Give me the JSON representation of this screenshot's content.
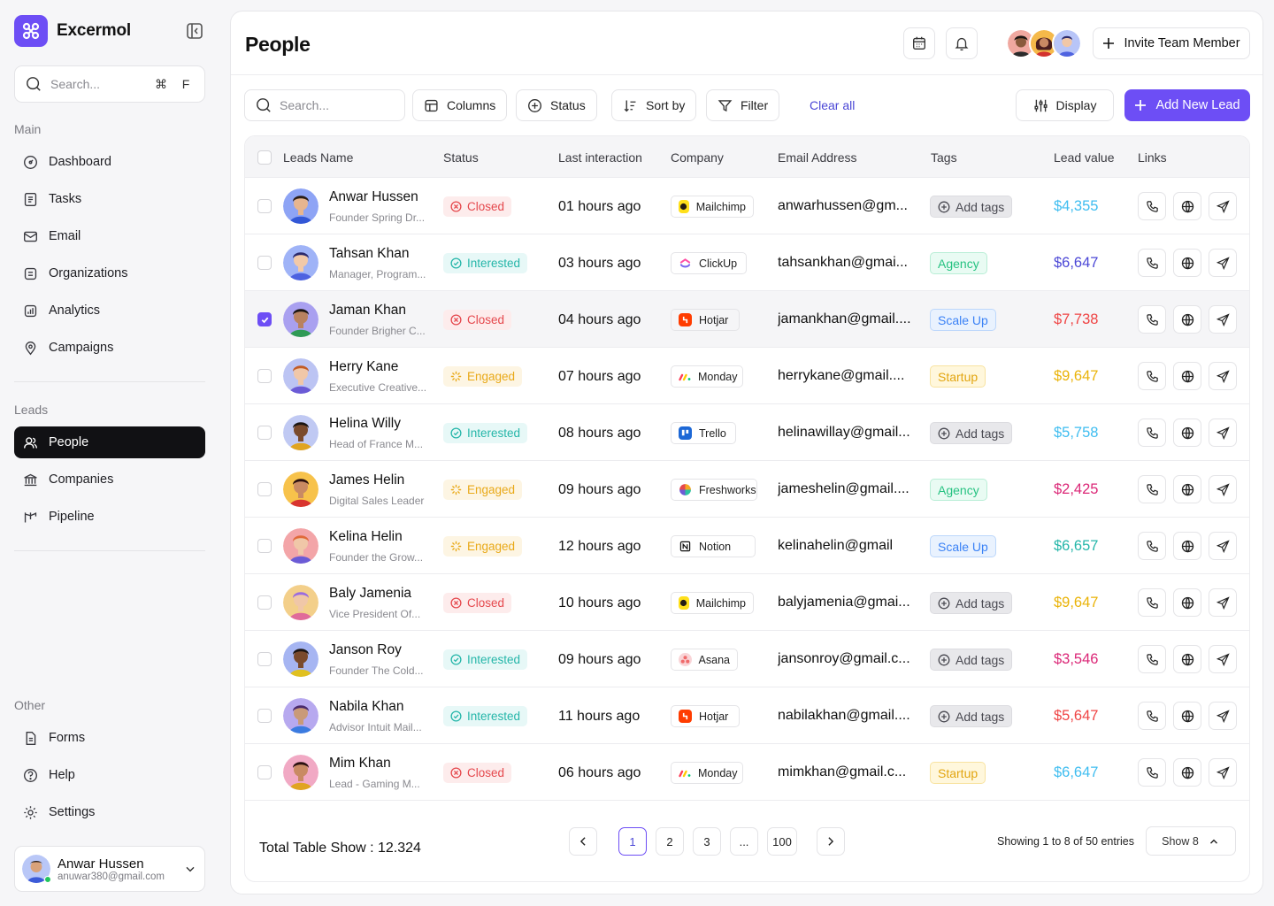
{
  "brand": {
    "name": "Excermol"
  },
  "sidebar": {
    "search_placeholder": "Search...",
    "shortcut_keys": [
      "⌘",
      "F"
    ],
    "sections": {
      "main": "Main",
      "leads": "Leads",
      "other": "Other"
    },
    "main_items": [
      "Dashboard",
      "Tasks",
      "Email",
      "Organizations",
      "Analytics",
      "Campaigns"
    ],
    "lead_items": [
      "People",
      "Companies",
      "Pipeline"
    ],
    "other_items": [
      "Forms",
      "Help",
      "Settings"
    ],
    "user": {
      "name": "Anwar Hussen",
      "email": "anuwar380@gmail.com"
    }
  },
  "header": {
    "title": "People",
    "invite_label": "Invite Team Member"
  },
  "toolbar": {
    "search_placeholder": "Search...",
    "columns": "Columns",
    "status": "Status",
    "sort_by": "Sort by",
    "filter": "Filter",
    "clear_all": "Clear all",
    "display": "Display",
    "add_new_lead": "Add New Lead"
  },
  "table": {
    "columns": [
      "Leads Name",
      "Status",
      "Last interaction",
      "Company",
      "Email Address",
      "Tags",
      "Lead value",
      "Links"
    ],
    "rows": [
      {
        "name": "Anwar Hussen",
        "subtitle": "Founder Spring Dr...",
        "status": "Closed",
        "last": "01 hours ago",
        "company": "Mailchimp",
        "email": "anwarhussen@gm...",
        "tag": "Add tags",
        "value": "$4,355",
        "value_color": "#3fbdf0"
      },
      {
        "name": "Tahsan Khan",
        "subtitle": "Manager, Program...",
        "status": "Interested",
        "last": "03 hours ago",
        "company": "ClickUp",
        "email": "tahsankhan@gmai...",
        "tag": "Agency",
        "value": "$6,647",
        "value_color": "#4b47d6"
      },
      {
        "name": "Jaman Khan",
        "subtitle": "Founder Brigher C...",
        "status": "Closed",
        "last": "04 hours ago",
        "company": "Hotjar",
        "email": "jamankhan@gmail....",
        "tag": "Scale Up",
        "value": "$7,738",
        "value_color": "#ef4444"
      },
      {
        "name": "Herry Kane",
        "subtitle": "Executive Creative...",
        "status": "Engaged",
        "last": "07 hours ago",
        "company": "Monday",
        "email": "herrykane@gmail....",
        "tag": "Startup",
        "value": "$9,647",
        "value_color": "#eab308"
      },
      {
        "name": "Helina Willy",
        "subtitle": "Head of France M...",
        "status": "Interested",
        "last": "08 hours ago",
        "company": "Trello",
        "email": "helinawillay@gmail...",
        "tag": "Add tags",
        "value": "$5,758",
        "value_color": "#3fbdf0"
      },
      {
        "name": "James Helin",
        "subtitle": "Digital Sales Leader",
        "status": "Engaged",
        "last": "09 hours ago",
        "company": "Freshworks",
        "email": "jameshelin@gmail....",
        "tag": "Agency",
        "value": "$2,425",
        "value_color": "#db2777"
      },
      {
        "name": "Kelina Helin",
        "subtitle": "Founder the Grow...",
        "status": "Engaged",
        "last": "12 hours ago",
        "company": "Notion",
        "email": "kelinahelin@gmail",
        "tag": "Scale Up",
        "value": "$6,657",
        "value_color": "#25b6a9"
      },
      {
        "name": "Baly Jamenia",
        "subtitle": "Vice President Of...",
        "status": "Closed",
        "last": "10 hours ago",
        "company": "Mailchimp",
        "email": "balyjamenia@gmai...",
        "tag": "Add tags",
        "value": "$9,647",
        "value_color": "#eab308"
      },
      {
        "name": "Janson Roy",
        "subtitle": "Founder The Cold...",
        "status": "Interested",
        "last": "09 hours ago",
        "company": "Asana",
        "email": "jansonroy@gmail.c...",
        "tag": "Add tags",
        "value": "$3,546",
        "value_color": "#db2777"
      },
      {
        "name": "Nabila Khan",
        "subtitle": "Advisor Intuit Mail...",
        "status": "Interested",
        "last": "11 hours ago",
        "company": "Hotjar",
        "email": "nabilakhan@gmail....",
        "tag": "Add tags",
        "value": "$5,647",
        "value_color": "#ef4444"
      },
      {
        "name": "Mim Khan",
        "subtitle": "Lead - Gaming M...",
        "status": "Closed",
        "last": "06 hours ago",
        "company": "Monday",
        "email": "mimkhan@gmail.c...",
        "tag": "Startup",
        "value": "$6,647",
        "value_color": "#3fbdf0"
      }
    ]
  },
  "footer": {
    "total": "Total Table Show : 12.324",
    "pages": [
      "1",
      "2",
      "3",
      "...",
      "100"
    ],
    "current_page": "1",
    "showing": "Showing 1 to 8 of 50 entries",
    "show_select": "Show 8"
  },
  "colors": {
    "accent": "#6d4ef5",
    "closed": "#e5484d",
    "interested": "#25b6a9",
    "engaged": "#e9a918"
  }
}
